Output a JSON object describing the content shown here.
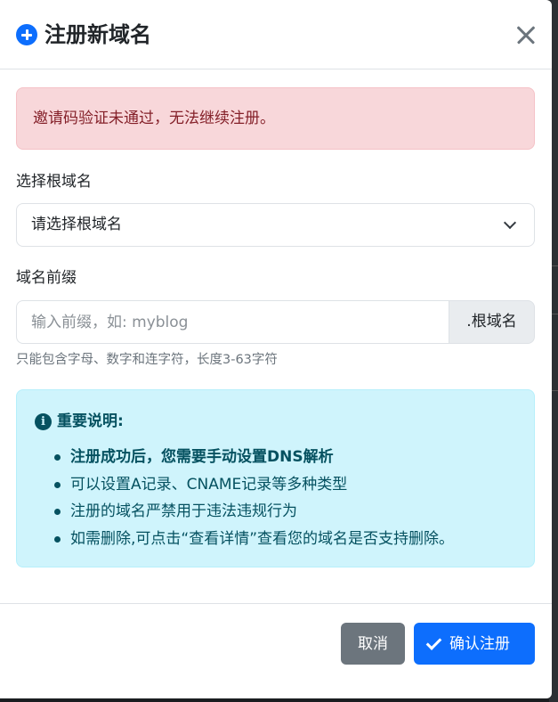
{
  "modal": {
    "title": "注册新域名",
    "title_icon": "plus-circle-icon",
    "close_icon": "close-icon"
  },
  "error_alert": {
    "message": "邀请码验证未通过，无法继续注册。"
  },
  "root_domain": {
    "label": "选择根域名",
    "selected": "请选择根域名"
  },
  "prefix": {
    "label": "域名前缀",
    "value": "",
    "placeholder": "输入前缀，如: myblog",
    "addon": ".根域名",
    "help": "只能包含字母、数字和连字符，长度3-63字符"
  },
  "info": {
    "icon": "info-circle-icon",
    "title": "重要说明:",
    "items": [
      "注册成功后，您需要手动设置DNS解析",
      "可以设置A记录、CNAME记录等多种类型",
      "注册的域名严禁用于违法违规行为",
      "如需删除,可点击“查看详情”查看您的域名是否支持删除。"
    ]
  },
  "footer": {
    "cancel_label": "取消",
    "confirm_label": "确认注册",
    "confirm_icon": "check-icon"
  },
  "colors": {
    "primary": "#0d6efd",
    "secondary": "#6c757d",
    "danger_bg": "#f8d7da",
    "danger_text": "#842029",
    "info_bg": "#cff4fc",
    "info_text": "#055160"
  }
}
